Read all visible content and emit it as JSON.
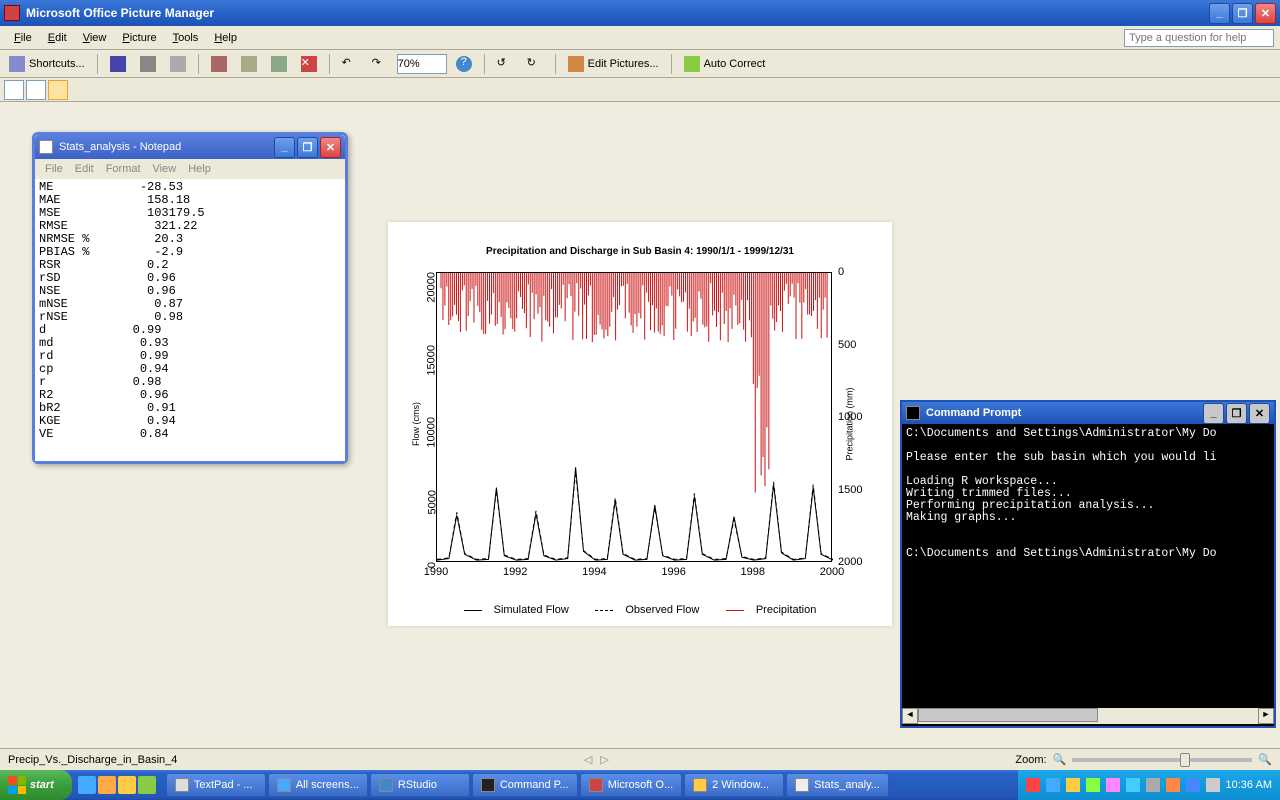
{
  "app": {
    "title": "Microsoft Office Picture Manager",
    "menus": [
      "File",
      "Edit",
      "View",
      "Picture",
      "Tools",
      "Help"
    ],
    "help_placeholder": "Type a question for help",
    "toolbar": {
      "shortcuts": "Shortcuts...",
      "zoom": "70%",
      "edit_pictures": "Edit Pictures...",
      "auto_correct": "Auto Correct"
    },
    "status": {
      "filename": "Precip_Vs._Discharge_in_Basin_4",
      "zoom_label": "Zoom:"
    }
  },
  "notepad": {
    "title": "Stats_analysis - Notepad",
    "menus": [
      "File",
      "Edit",
      "Format",
      "View",
      "Help"
    ],
    "lines": [
      [
        "ME",
        "-28.53"
      ],
      [
        "MAE",
        "158.18"
      ],
      [
        "MSE",
        "103179.5"
      ],
      [
        "RMSE",
        "321.22"
      ],
      [
        "NRMSE %",
        "20.3"
      ],
      [
        "PBIAS %",
        "-2.9"
      ],
      [
        "RSR",
        "0.2"
      ],
      [
        "rSD",
        "0.96"
      ],
      [
        "NSE",
        "0.96"
      ],
      [
        "mNSE",
        "0.87"
      ],
      [
        "rNSE",
        "0.98"
      ],
      [
        "d",
        "0.99"
      ],
      [
        "md",
        "0.93"
      ],
      [
        "rd",
        "0.99"
      ],
      [
        "cp",
        "0.94"
      ],
      [
        "r",
        "0.98"
      ],
      [
        "R2",
        "0.96"
      ],
      [
        "bR2",
        "0.91"
      ],
      [
        "KGE",
        "0.94"
      ],
      [
        "VE",
        "0.84"
      ]
    ]
  },
  "chart_data": {
    "type": "line",
    "title": "Precipitation and Discharge in Sub Basin 4: 1990/1/1 - 1999/12/31",
    "xlabel": "",
    "y_left_label": "Flow (cms)",
    "y_right_label": "Precipitation (mm)",
    "x_ticks": [
      1990,
      1992,
      1994,
      1996,
      1998,
      2000
    ],
    "y_left_ticks": [
      0,
      5000,
      10000,
      15000,
      20000
    ],
    "y_right_ticks": [
      0,
      500,
      1000,
      1500,
      2000
    ],
    "series": [
      {
        "name": "Simulated Flow",
        "axis": "left",
        "style": "solid",
        "color": "#000",
        "x": [
          1990.0,
          1990.3,
          1990.5,
          1990.7,
          1991.0,
          1991.3,
          1991.5,
          1991.7,
          1992.0,
          1992.3,
          1992.5,
          1992.7,
          1993.0,
          1993.3,
          1993.5,
          1993.7,
          1994.0,
          1994.3,
          1994.5,
          1994.7,
          1995.0,
          1995.3,
          1995.5,
          1995.7,
          1996.0,
          1996.3,
          1996.5,
          1996.7,
          1997.0,
          1997.3,
          1997.5,
          1997.7,
          1998.0,
          1998.3,
          1998.5,
          1998.7,
          1999.0,
          1999.3,
          1999.5,
          1999.7,
          2000.0
        ],
        "y": [
          200,
          300,
          3300,
          600,
          200,
          250,
          5200,
          500,
          200,
          250,
          3400,
          500,
          200,
          300,
          6600,
          800,
          200,
          250,
          4300,
          600,
          200,
          250,
          4000,
          500,
          200,
          250,
          4600,
          600,
          200,
          250,
          3200,
          400,
          200,
          300,
          5400,
          700,
          200,
          300,
          5200,
          600,
          200
        ]
      },
      {
        "name": "Observed Flow",
        "axis": "left",
        "style": "dashed",
        "color": "#000",
        "x": [
          1990.0,
          1990.3,
          1990.5,
          1990.7,
          1991.0,
          1991.3,
          1991.5,
          1991.7,
          1992.0,
          1992.3,
          1992.5,
          1992.7,
          1993.0,
          1993.3,
          1993.5,
          1993.7,
          1994.0,
          1994.3,
          1994.5,
          1994.7,
          1995.0,
          1995.3,
          1995.5,
          1995.7,
          1996.0,
          1996.3,
          1996.5,
          1996.7,
          1997.0,
          1997.3,
          1997.5,
          1997.7,
          1998.0,
          1998.3,
          1998.5,
          1998.7,
          1999.0,
          1999.3,
          1999.5,
          1999.7,
          2000.0
        ],
        "y": [
          250,
          350,
          3500,
          650,
          250,
          300,
          5000,
          550,
          250,
          300,
          3600,
          550,
          250,
          350,
          6300,
          850,
          250,
          300,
          4500,
          650,
          250,
          300,
          3800,
          550,
          250,
          300,
          4800,
          650,
          250,
          300,
          3000,
          450,
          250,
          350,
          5600,
          750,
          250,
          350,
          5400,
          650,
          250
        ]
      },
      {
        "name": "Precipitation",
        "axis": "right",
        "style": "bars_from_top",
        "color": "#c11",
        "note": "dense bars hanging from top; mostly 50-400mm with occasional spikes to ~1300mm around 1998"
      }
    ],
    "legend": [
      "Simulated Flow",
      "Observed Flow",
      "Precipitation"
    ]
  },
  "cmd": {
    "title": "Command Prompt",
    "lines": [
      "C:\\Documents and Settings\\Administrator\\My Do",
      "",
      "Please enter the sub basin which you would li",
      "",
      "Loading R workspace...",
      "Writing trimmed files...",
      "Performing precipitation analysis...",
      "Making graphs...",
      "",
      "",
      "C:\\Documents and Settings\\Administrator\\My Do"
    ]
  },
  "taskbar": {
    "start": "start",
    "tasks": [
      {
        "label": "TextPad - ...",
        "color": "#ddd"
      },
      {
        "label": "All screens...",
        "color": "#4af"
      },
      {
        "label": "RStudio",
        "color": "#48c"
      },
      {
        "label": "Command P...",
        "color": "#222"
      },
      {
        "label": "Microsoft O...",
        "color": "#c44"
      },
      {
        "label": "2 Window...",
        "color": "#fc4"
      },
      {
        "label": "Stats_analy...",
        "color": "#eee"
      }
    ],
    "clock": "10:36 AM"
  }
}
